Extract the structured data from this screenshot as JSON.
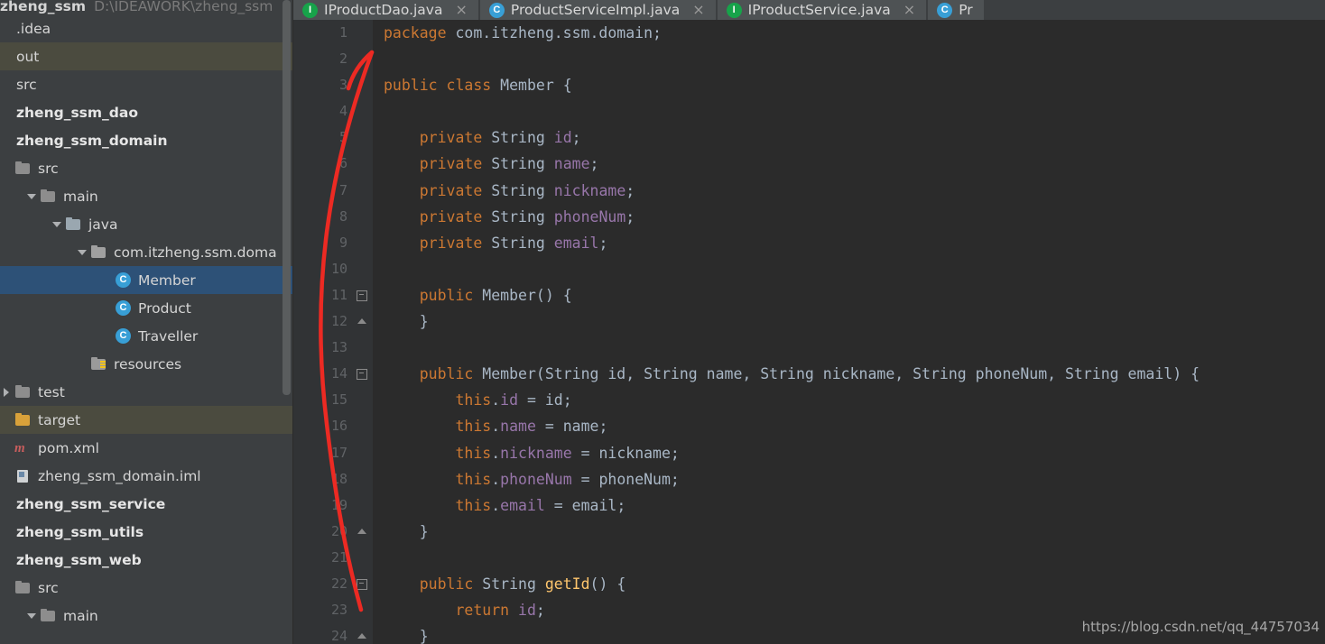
{
  "sidebar": {
    "top_partial": {
      "name": "zheng_ssm",
      "path": "D:\\IDEAWORK\\zheng_ssm"
    },
    "items": [
      {
        "label": ".idea",
        "icon": "none",
        "indent": 0,
        "arrow": "none",
        "bold": false,
        "state": "normal"
      },
      {
        "label": "out",
        "icon": "none",
        "indent": 0,
        "arrow": "none",
        "bold": false,
        "state": "highlight"
      },
      {
        "label": "src",
        "icon": "none",
        "indent": 0,
        "arrow": "none",
        "bold": false,
        "state": "normal"
      },
      {
        "label": "zheng_ssm_dao",
        "icon": "none",
        "indent": 0,
        "arrow": "none",
        "bold": true,
        "state": "normal"
      },
      {
        "label": "zheng_ssm_domain",
        "icon": "none",
        "indent": 0,
        "arrow": "none",
        "bold": true,
        "state": "normal"
      },
      {
        "label": "src",
        "icon": "folder",
        "indent": 0,
        "arrow": "none",
        "bold": false,
        "state": "normal"
      },
      {
        "label": "main",
        "icon": "folder",
        "indent": 1,
        "arrow": "down",
        "bold": false,
        "state": "normal"
      },
      {
        "label": "java",
        "icon": "folder-src",
        "indent": 2,
        "arrow": "down",
        "bold": false,
        "state": "normal"
      },
      {
        "label": "com.itzheng.ssm.doma",
        "icon": "folder-pkg",
        "indent": 3,
        "arrow": "down",
        "bold": false,
        "state": "normal"
      },
      {
        "label": "Member",
        "icon": "class",
        "indent": 4,
        "arrow": "none",
        "bold": false,
        "state": "selected"
      },
      {
        "label": "Product",
        "icon": "class",
        "indent": 4,
        "arrow": "none",
        "bold": false,
        "state": "normal"
      },
      {
        "label": "Traveller",
        "icon": "class",
        "indent": 4,
        "arrow": "none",
        "bold": false,
        "state": "normal"
      },
      {
        "label": "resources",
        "icon": "folder-res",
        "indent": 3,
        "arrow": "none",
        "bold": false,
        "state": "normal"
      },
      {
        "label": "test",
        "icon": "folder",
        "indent": 0,
        "arrow": "right",
        "bold": false,
        "state": "normal"
      },
      {
        "label": "target",
        "icon": "folder-target",
        "indent": 0,
        "arrow": "none",
        "bold": false,
        "state": "highlight"
      },
      {
        "label": "pom.xml",
        "icon": "maven",
        "indent": 0,
        "arrow": "none",
        "bold": false,
        "state": "normal"
      },
      {
        "label": "zheng_ssm_domain.iml",
        "icon": "iml",
        "indent": 0,
        "arrow": "none",
        "bold": false,
        "state": "normal"
      },
      {
        "label": "zheng_ssm_service",
        "icon": "none",
        "indent": 0,
        "arrow": "none",
        "bold": true,
        "state": "normal"
      },
      {
        "label": "zheng_ssm_utils",
        "icon": "none",
        "indent": 0,
        "arrow": "none",
        "bold": true,
        "state": "normal"
      },
      {
        "label": "zheng_ssm_web",
        "icon": "none",
        "indent": 0,
        "arrow": "none",
        "bold": true,
        "state": "normal"
      },
      {
        "label": "src",
        "icon": "folder",
        "indent": 0,
        "arrow": "none",
        "bold": false,
        "state": "normal"
      },
      {
        "label": "main",
        "icon": "folder",
        "indent": 1,
        "arrow": "down",
        "bold": false,
        "state": "normal"
      }
    ]
  },
  "tabs": [
    {
      "label": "IProductDao.java",
      "icon": "interface",
      "close": "×"
    },
    {
      "label": "ProductServiceImpl.java",
      "icon": "class",
      "close": "×"
    },
    {
      "label": "IProductService.java",
      "icon": "interface",
      "close": "×"
    },
    {
      "label": "Pr",
      "icon": "class",
      "close": ""
    }
  ],
  "editor": {
    "line_numbers": [
      "1",
      "2",
      "3",
      "4",
      "5",
      "6",
      "7",
      "8",
      "9",
      "10",
      "11",
      "12",
      "13",
      "14",
      "15",
      "16",
      "17",
      "18",
      "19",
      "20",
      "21",
      "22",
      "23",
      "24"
    ],
    "lines": [
      "package com.itzheng.ssm.domain;",
      "",
      "public class Member {",
      "",
      "    private String id;",
      "    private String name;",
      "    private String nickname;",
      "    private String phoneNum;",
      "    private String email;",
      "",
      "    public Member() {",
      "    }",
      "",
      "    public Member(String id, String name, String nickname, String phoneNum, String email) {",
      "        this.id = id;",
      "        this.name = name;",
      "        this.nickname = nickname;",
      "        this.phoneNum = phoneNum;",
      "        this.email = email;",
      "    }",
      "",
      "    public String getId() {",
      "        return id;",
      "    }"
    ]
  },
  "watermark": "https://blog.csdn.net/qq_44757034",
  "colors": {
    "sidebar_bg": "#3c3f41",
    "editor_bg": "#2b2b2b",
    "gutter_bg": "#313335",
    "selection": "#2d5177",
    "highlight": "#4b4b3f",
    "keyword": "#cc7832",
    "field": "#9876aa",
    "method": "#ffc66d",
    "text": "#a9b7c6",
    "annotation_arrow": "#ec2a23"
  }
}
